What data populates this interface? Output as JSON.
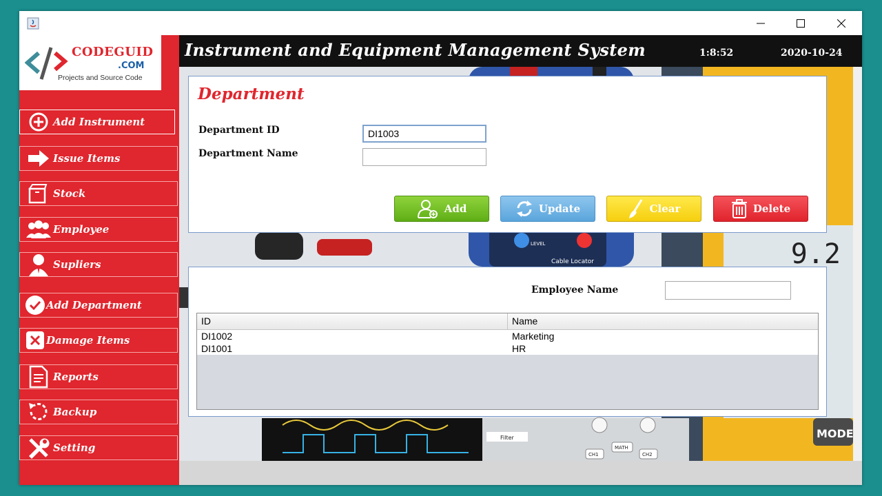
{
  "header": {
    "title": "Instrument and Equipment Management System",
    "time": "1:8:52",
    "date": "2020-10-24"
  },
  "logo": {
    "name": "CODEGUID",
    "suffix": ".COM",
    "tagline": "Projects and Source Code"
  },
  "sidebar": {
    "items": [
      {
        "label": "Add Instrument",
        "icon": "plus-circle-icon"
      },
      {
        "label": "Issue Items",
        "icon": "arrow-right-icon"
      },
      {
        "label": "Stock",
        "icon": "box-icon"
      },
      {
        "label": "Employee",
        "icon": "group-icon"
      },
      {
        "label": "Supliers",
        "icon": "person-icon"
      },
      {
        "label": "Add Department",
        "icon": "check-circle-icon"
      },
      {
        "label": "Damage Items",
        "icon": "x-box-icon"
      },
      {
        "label": "Reports",
        "icon": "report-icon"
      },
      {
        "label": "Backup",
        "icon": "backup-icon"
      },
      {
        "label": "Setting",
        "icon": "wrench-icon"
      }
    ]
  },
  "form": {
    "title": "Department",
    "id_label": "Department ID",
    "id_value": "DI1003",
    "name_label": "Department Name",
    "name_value": ""
  },
  "buttons": {
    "add": "Add",
    "update": "Update",
    "clear": "Clear",
    "delete": "Delete"
  },
  "search": {
    "label": "Employee Name",
    "value": ""
  },
  "table": {
    "columns": [
      "ID",
      "Name"
    ],
    "rows": [
      [
        "DI1002",
        "Marketing"
      ],
      [
        "DI1001",
        "HR"
      ]
    ]
  },
  "background_readouts": {
    "level": "LEVEL",
    "cable_locator": "Cable Locator",
    "filter": "Filter",
    "math": "MATH",
    "ch1": "CH1",
    "ch2": "CH2",
    "mode": "MODE",
    "display_digit": "9.2"
  },
  "colors": {
    "accent_red": "#e0262e",
    "header_black": "#111111",
    "desktop_teal": "#1a8f8e"
  }
}
